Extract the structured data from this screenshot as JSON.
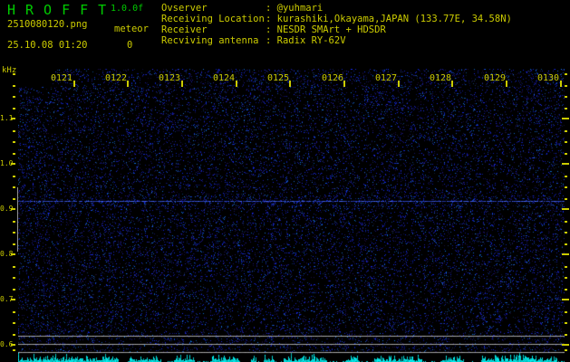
{
  "header": {
    "app_title": "HROFFT",
    "version": "1.0.0f",
    "filename": "2510080120.png",
    "meteor_label": "meteor",
    "meteor_count": "0",
    "timestamp": "25.10.08 01:20",
    "separator": ": ",
    "info": [
      {
        "label": "Ovserver",
        "value": "@yuhmari"
      },
      {
        "label": "Receiving Location",
        "value": "kurashiki,Okayama,JAPAN (133.77E, 34.58N)"
      },
      {
        "label": "Receiver",
        "value": "NESDR SMArt + HDSDR"
      },
      {
        "label": "Recviving antenna",
        "value": "Radix RY-62V"
      }
    ]
  },
  "chart_data": {
    "type": "heatmap",
    "title": "HROFFT 10-minute radio meteor echo spectrogram",
    "ylabel": "kHz",
    "y_ticks": [
      "1.1",
      "1.0",
      "0.9",
      "0.8",
      "0.7",
      "0.6"
    ],
    "y_tick_interval_khz": 0.1,
    "y_minor_interval_khz": 0.025,
    "y_range_khz": [
      0.58,
      1.21
    ],
    "x_ticks": [
      "0121",
      "0122",
      "0123",
      "0124",
      "0125",
      "0126",
      "0127",
      "0128",
      "0129",
      "0130"
    ],
    "x_interval": "1 minute",
    "meteor_echo_count": 0,
    "horizontal_carrier_lines_khz": [
      0.92,
      0.62,
      0.6,
      0.58
    ],
    "background_texture": "sparse dark-blue random noise speckle on black",
    "bottom_strip": "cyan signal-level spikes per time column",
    "left_marker": "gray vertical segment spanning ~0.80-0.95 kHz at plot left edge",
    "grid": "off",
    "legend": "none",
    "colors": {
      "bg": "#000000",
      "title_green": "#00cc00",
      "label_yellow": "#cccc00",
      "noise_blue": "#2030c0",
      "carrier_blue": "#3c50d2",
      "carrier_gray": "#a8a8a8",
      "marker_gray": "#909090",
      "trace_cyan": "#00e0e0"
    }
  }
}
